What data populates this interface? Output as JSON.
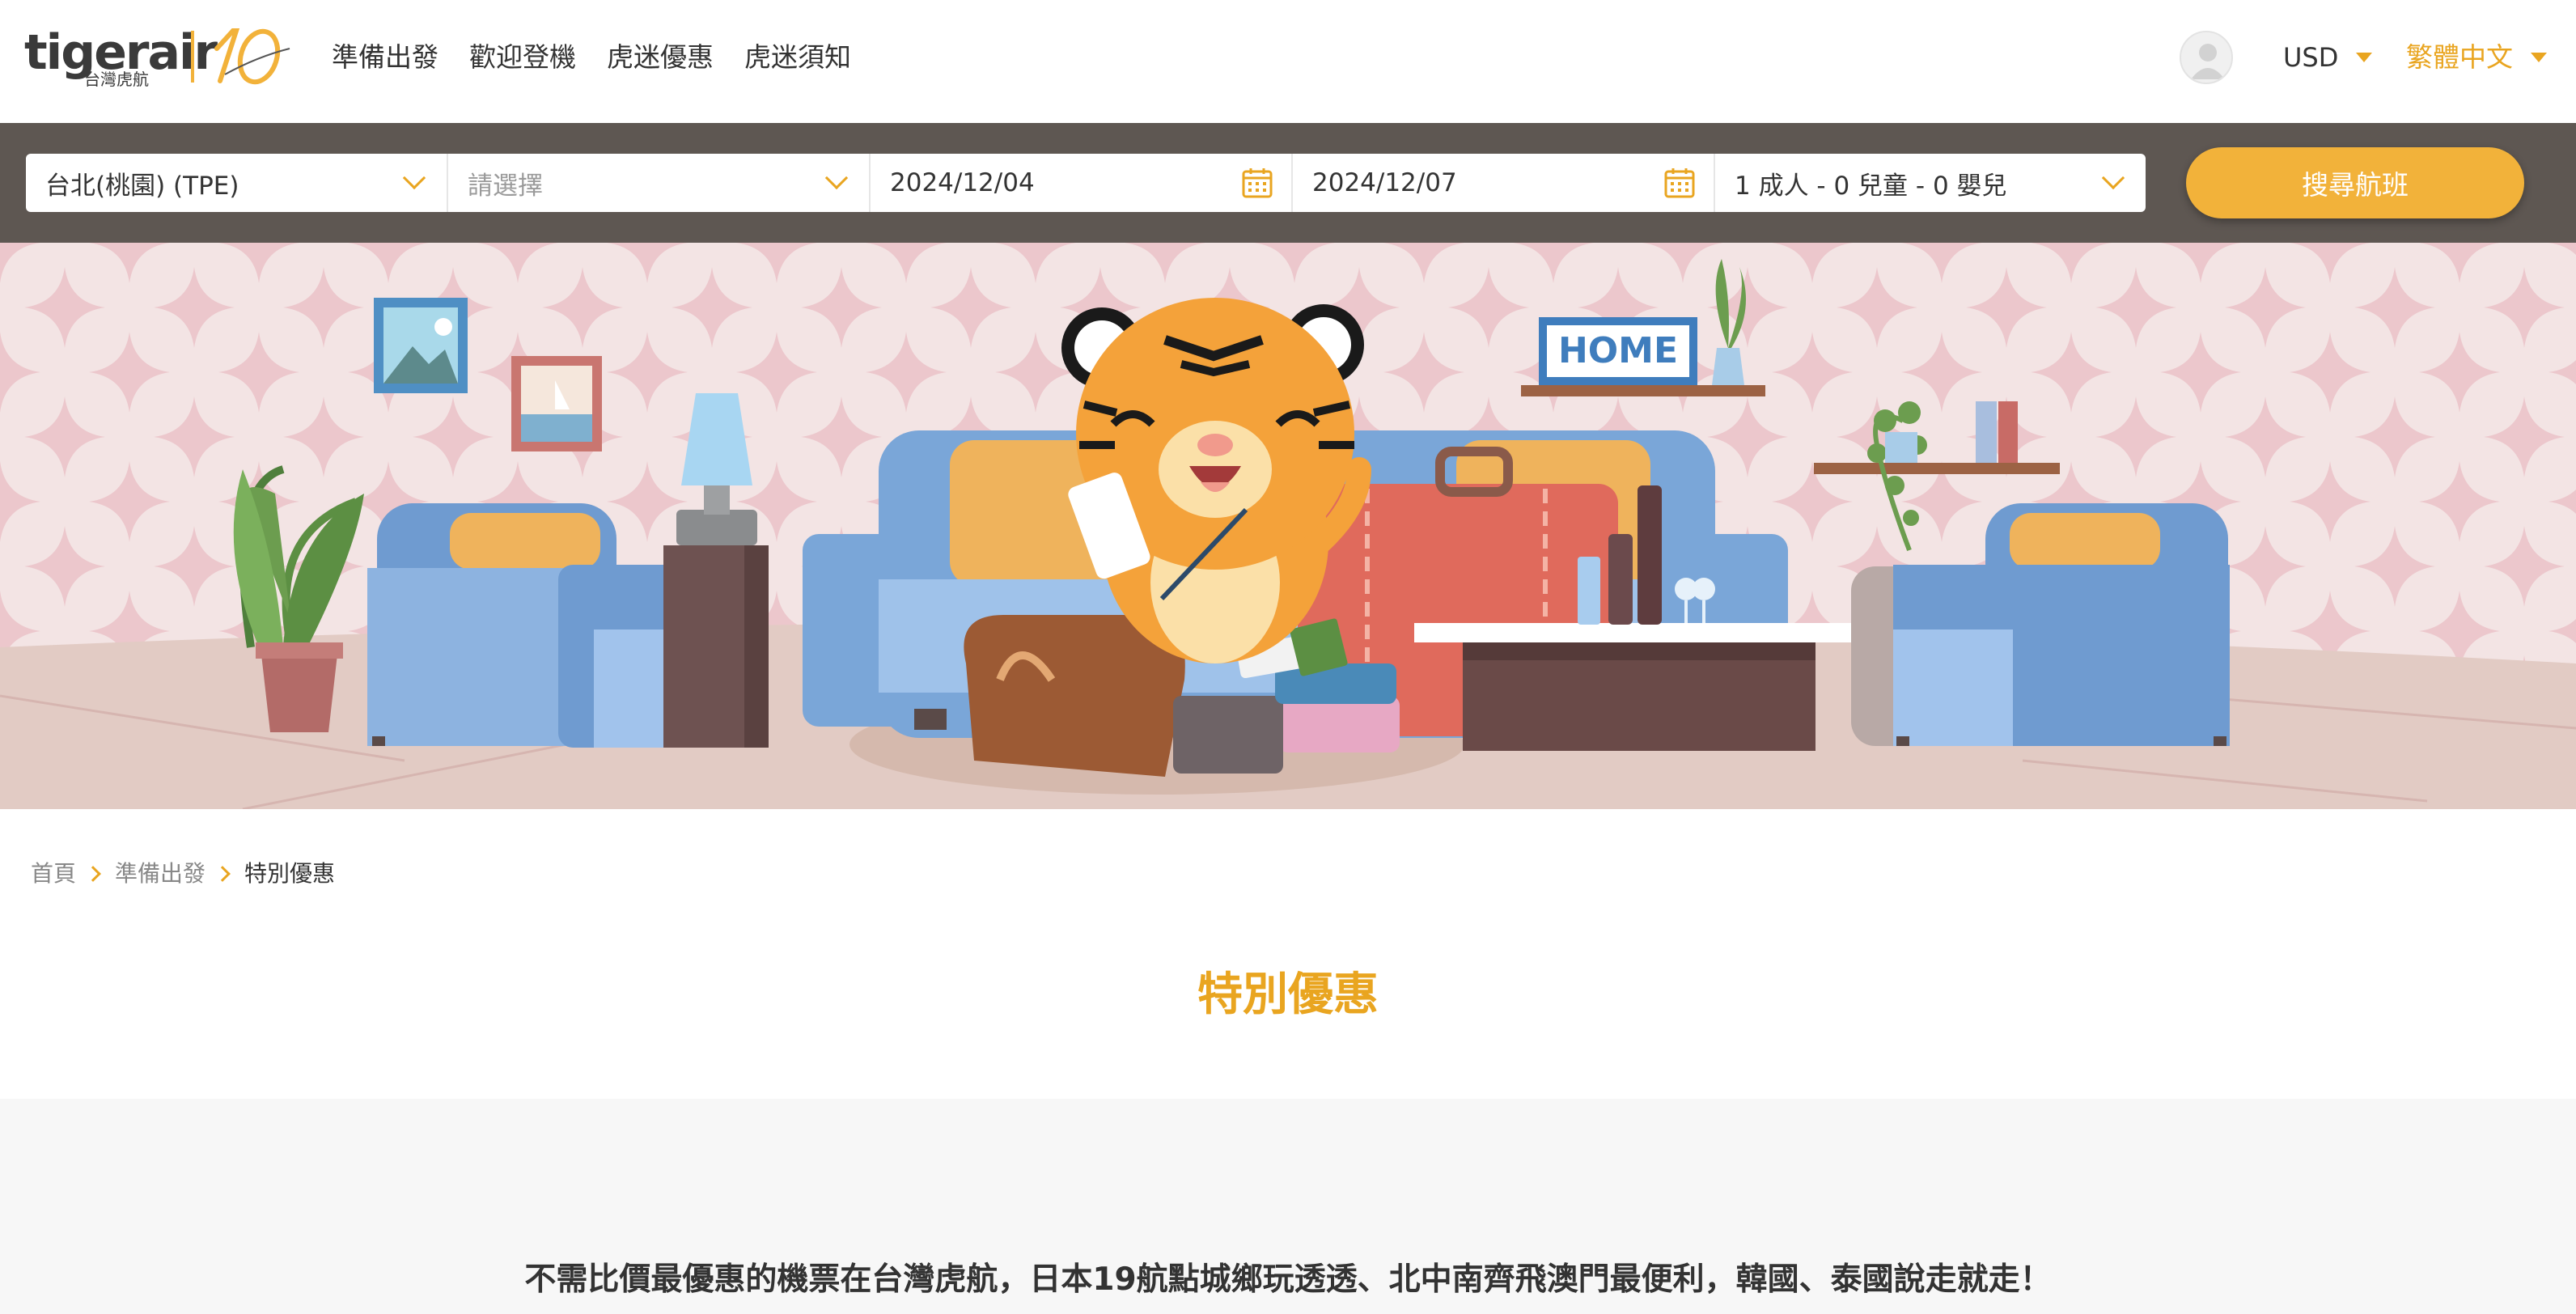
{
  "header": {
    "logo_text": "tigerair",
    "logo_sub": "台灣虎航",
    "nav": [
      "準備出發",
      "歡迎登機",
      "虎迷優惠",
      "虎迷須知"
    ],
    "currency": "USD",
    "language": "繁體中文"
  },
  "search": {
    "origin": "台北(桃園) (TPE)",
    "destination_placeholder": "請選擇",
    "depart_date": "2024/12/04",
    "return_date": "2024/12/07",
    "passengers": "1 成人 - 0 兒童 - 0 嬰兒",
    "search_button": "搜尋航班"
  },
  "hero": {
    "sign_text": "HOME"
  },
  "breadcrumb": {
    "home": "首頁",
    "parent": "準備出發",
    "current": "特別優惠"
  },
  "page": {
    "title": "特別優惠",
    "intro": "不需比價最優惠的機票在台灣虎航，日本19航點城鄉玩透透、北中南齊飛澳門最便利，韓國、泰國說走就走！"
  },
  "colors": {
    "accent": "#f2b23a",
    "search_bar_bg": "#5e5752",
    "hero_wall": "#f3e4e4",
    "sofa_blue": "#7aa6d8"
  }
}
